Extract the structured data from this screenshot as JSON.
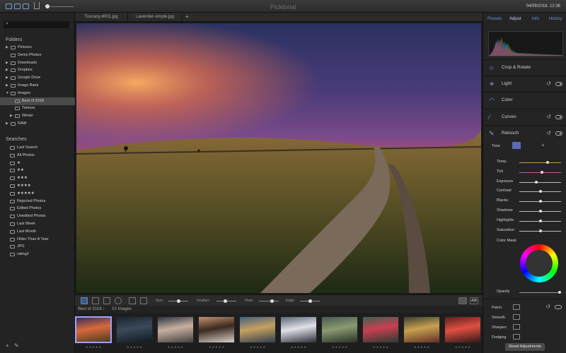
{
  "app": {
    "title": "Picktorial",
    "datetime": "04/09/2018, 12:36"
  },
  "tabs": [
    {
      "label": "Tuscany-6001.jpg"
    },
    {
      "label": "Lavender-simple.jpg"
    }
  ],
  "tab_plus": "+",
  "search": {
    "icon_glyph": "⌕",
    "placeholder": ""
  },
  "sidebar": {
    "folders_title": "Folders",
    "folders": [
      {
        "label": "Pictures",
        "arrow": "▶"
      },
      {
        "label": "Demo Photos",
        "arrow": ""
      },
      {
        "label": "Downloads",
        "arrow": "▶"
      },
      {
        "label": "Dropbox",
        "arrow": "▶"
      },
      {
        "label": "Google Drive",
        "arrow": "▶"
      },
      {
        "label": "Image Bank",
        "arrow": "▶"
      },
      {
        "label": "Images",
        "arrow": "▼"
      },
      {
        "label": "Best of 2018",
        "arrow": "",
        "selected": true
      },
      {
        "label": "Tamara",
        "arrow": ""
      },
      {
        "label": "Winter",
        "arrow": "▶"
      },
      {
        "label": "RAW",
        "arrow": "▶"
      }
    ],
    "searches_title": "Searches",
    "searches": [
      "Last Search",
      "All Photos",
      "★",
      "★★",
      "★★★",
      "★★★★",
      "★★★★★",
      "Rejected Photos",
      "Edited Photos",
      "Unedited Photos",
      "Last Week",
      "Last Month",
      "Older Than A Year",
      "JPG",
      "rating2"
    ],
    "footer_add": "+",
    "footer_edit": "✎"
  },
  "toolbar": {
    "size_label": "Size:",
    "feather_label": "Feather:",
    "flow_label": "Flow:",
    "edge_label": "Edge:",
    "view_ab": "A|B"
  },
  "filmstrip": {
    "album": "Best of 2018",
    "count": "10 Images",
    "thumbnails": [
      {
        "colors": [
          "#3a2c5c",
          "#d86a3a",
          "#4a3a2a"
        ],
        "rating": "★★★★★",
        "selected": true
      },
      {
        "colors": [
          "#1a2430",
          "#3a4a5a",
          "#101820"
        ],
        "rating": "★★★★★"
      },
      {
        "colors": [
          "#2a3440",
          "#c8b0a0",
          "#404040"
        ],
        "rating": "★★★★★"
      },
      {
        "colors": [
          "#c89070",
          "#3a2a20",
          "#d8d0c8"
        ],
        "rating": "★★★★★"
      },
      {
        "colors": [
          "#406080",
          "#c8a060",
          "#304050"
        ],
        "rating": "★★★★★"
      },
      {
        "colors": [
          "#5a6878",
          "#e0e0e8",
          "#2a3038"
        ],
        "rating": "★★★★★"
      },
      {
        "colors": [
          "#4a5a50",
          "#8a9a70",
          "#2a3028"
        ],
        "rating": "★★★★★"
      },
      {
        "colors": [
          "#406050",
          "#c84050",
          "#2a3a30"
        ],
        "rating": "★★★★★"
      },
      {
        "colors": [
          "#3a4030",
          "#c8a050",
          "#603028"
        ],
        "rating": "★★★★★"
      },
      {
        "colors": [
          "#5a2020",
          "#e05040",
          "#301818"
        ],
        "rating": "★★★★★"
      }
    ]
  },
  "right_panel": {
    "tabs": [
      "Presets",
      "Adjust",
      "Info",
      "History"
    ],
    "active_tab": "Adjust",
    "tools": [
      {
        "label": "Crop & Rotate",
        "icon": "crop-icon",
        "undo": false
      },
      {
        "label": "Light",
        "icon": "light-icon",
        "undo": true
      },
      {
        "label": "Color",
        "icon": "color-icon",
        "undo": false
      },
      {
        "label": "Curves",
        "icon": "curves-icon",
        "undo": true
      },
      {
        "label": "Retouch",
        "icon": "retouch-icon",
        "undo": true
      }
    ],
    "undo_glyph": "↺",
    "tone_label": "Tone",
    "tone_add": "+",
    "adjustments": [
      {
        "label": "Temp.",
        "value": 0.68,
        "color": "#c8a040"
      },
      {
        "label": "Tint",
        "value": 0.55,
        "color": "#c060a0"
      },
      {
        "label": "Exposure",
        "value": 0.4,
        "color": "#bbbbbb"
      },
      {
        "label": "Contrast",
        "value": 0.5,
        "color": "#bbbbbb"
      },
      {
        "label": "Blacks",
        "value": 0.5,
        "color": "#bbbbbb"
      },
      {
        "label": "Shadows",
        "value": 0.5,
        "color": "#bbbbbb"
      },
      {
        "label": "Highlights",
        "value": 0.5,
        "color": "#bbbbbb"
      },
      {
        "label": "Saturation",
        "value": 0.5,
        "color": "#bbbbbb"
      }
    ],
    "color_mask_label": "Color Mask",
    "opacity_label": "Opacity",
    "opacity_value": 1.0,
    "retouch_rows": [
      "Patch",
      "Smooth",
      "Sharpen",
      "Dodging"
    ],
    "reset_button": "Reset Adjustments"
  },
  "colors": {
    "accent": "#6f93d6",
    "selected_thumb": "#9aa6ff"
  }
}
